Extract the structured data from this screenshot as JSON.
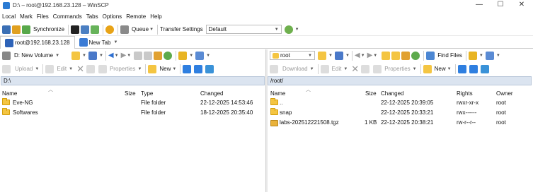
{
  "window": {
    "title": "D:\\ – root@192.168.23.128 – WinSCP",
    "minimize": "—",
    "maximize": "☐",
    "close": "✕"
  },
  "menu": [
    "Local",
    "Mark",
    "Files",
    "Commands",
    "Tabs",
    "Options",
    "Remote",
    "Help"
  ],
  "toolbar": {
    "synchronize": "Synchronize",
    "queue": "Queue",
    "transfer_settings_label": "Transfer Settings",
    "transfer_settings_value": "Default"
  },
  "tabs": {
    "session": "root@192.168.23.128",
    "new_tab": "New Tab"
  },
  "local": {
    "drive": "D: New Volume",
    "upload": "Upload",
    "edit": "Edit",
    "properties": "Properties",
    "new": "New",
    "path": "D:\\",
    "columns": [
      "Name",
      "Size",
      "Type",
      "Changed"
    ],
    "files": [
      {
        "name": "Eve-NG",
        "size": "",
        "type": "File folder",
        "changed": "22-12-2025 14:53:46"
      },
      {
        "name": "Softwares",
        "size": "",
        "type": "File folder",
        "changed": "18-12-2025 20:35:40"
      }
    ]
  },
  "remote": {
    "dir": "root",
    "find_files": "Find Files",
    "download": "Download",
    "edit": "Edit",
    "properties": "Properties",
    "new": "New",
    "path": "/root/",
    "columns": [
      "Name",
      "Size",
      "Changed",
      "Rights",
      "Owner"
    ],
    "files": [
      {
        "name": "..",
        "size": "",
        "changed": "22-12-2025 20:39:05",
        "rights": "rwxr-xr-x",
        "owner": "root"
      },
      {
        "name": "snap",
        "size": "",
        "changed": "22-12-2025 20:33:21",
        "rights": "rwx------",
        "owner": "root"
      },
      {
        "name": "labs-202512221508.tgz",
        "size": "1 KB",
        "changed": "22-12-2025 20:38:21",
        "rights": "rw-r--r--",
        "owner": "root"
      }
    ]
  }
}
